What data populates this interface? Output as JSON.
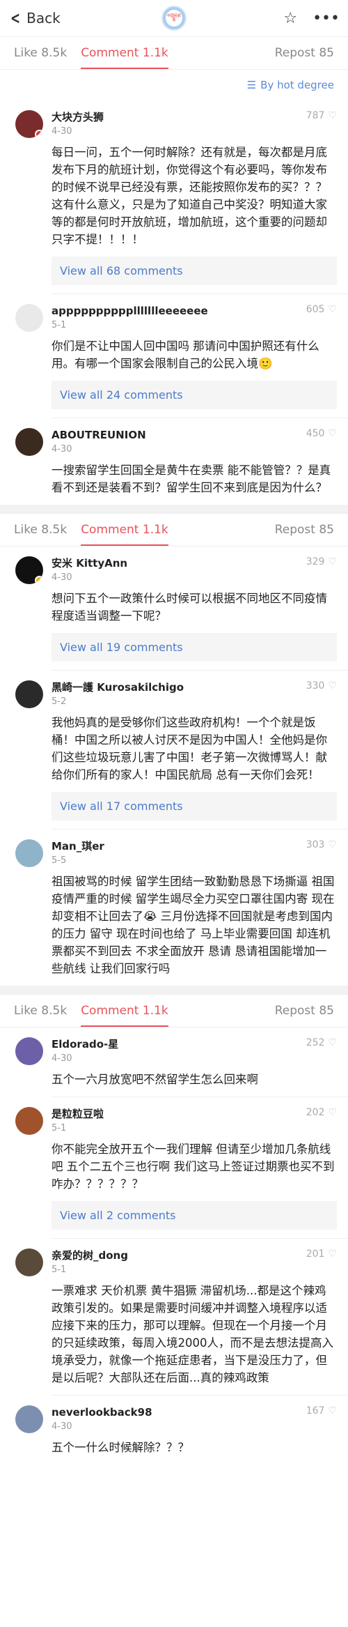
{
  "topbar": {
    "back_label": "Back",
    "logo_text": "中国民航局"
  },
  "tabs": {
    "like": "Like 8.5k",
    "comment": "Comment 1.1k",
    "repost": "Repost 85"
  },
  "sort": {
    "label": "By hot degree"
  },
  "sections": [
    {
      "comments": [
        {
          "name": "大块方头狮",
          "date": "4-30",
          "likes": "787",
          "avatar_color": "#7a2b2b",
          "badge_color": "#e03b3b",
          "text": "每日一问，五个一何时解除？还有就是，每次都是月底发布下月的航班计划，你觉得这个有必要吗，等你发布的时候不说早已经没有票，还能按照你发布的买？？？这有什么意义，只是为了知道自己中奖没？明知道大家等的都是何时开放航班，增加航班，这个重要的问题却只字不提！！！！",
          "view_all": "View all 68 comments"
        },
        {
          "name": "appppppppppllllllleeeeeee",
          "date": "5-1",
          "likes": "605",
          "avatar_color": "#e9e9e9",
          "badge_color": "",
          "text": "你们是不让中国人回中国吗 那请问中国护照还有什么用。有哪一个国家会限制自己的公民入境🙂",
          "view_all": "View all 24 comments"
        },
        {
          "name": "ABOUTREUNION",
          "date": "4-30",
          "likes": "450",
          "avatar_color": "#3b2a20",
          "badge_color": "",
          "text": "一搜索留学生回国全是黄牛在卖票 能不能管管？？是真看不到还是装看不到？留学生回不来到底是因为什么？",
          "view_all": ""
        }
      ]
    },
    {
      "comments": [
        {
          "name": "安米 KittyAnn",
          "date": "4-30",
          "likes": "329",
          "avatar_color": "#111111",
          "badge_color": "#f2b705",
          "text": "想问下五个一政策什么时候可以根据不同地区不同疫情程度适当调整一下呢？",
          "view_all": "View all 19 comments"
        },
        {
          "name": "黑崎一護 Kurosakilchigo",
          "date": "5-2",
          "likes": "330",
          "avatar_color": "#2a2a2a",
          "badge_color": "",
          "text": "我他妈真的是受够你们这些政府机构！一个个就是饭桶！中国之所以被人讨厌不是因为中国人！全他妈是你们这些垃圾玩意儿害了中国！老子第一次微博骂人！献给你们所有的家人！中国民航局 总有一天你们会死！",
          "view_all": "View all 17 comments"
        },
        {
          "name": "Man_琪er",
          "date": "5-5",
          "likes": "303",
          "avatar_color": "#8fb3c9",
          "badge_color": "",
          "text": "祖国被骂的时候 留学生团结一致勤勤恳恳下场撕逼 祖国疫情严重的时候 留学生竭尽全力买空口罩往国内寄 现在却变相不让回去了😭 三月份选择不回国就是考虑到国内的压力 留守 现在时间也给了 马上毕业需要回国 却连机票都买不到回去 不求全面放开 恳请 恳请祖国能增加一些航线 让我们回家行吗",
          "view_all": ""
        }
      ]
    },
    {
      "comments": [
        {
          "name": "Eldorado-星",
          "date": "4-30",
          "likes": "252",
          "avatar_color": "#6d5fa8",
          "badge_color": "",
          "text": "五个一六月放宽吧不然留学生怎么回来啊",
          "view_all": ""
        },
        {
          "name": "是粒粒豆啦",
          "date": "5-1",
          "likes": "202",
          "avatar_color": "#a0522d",
          "badge_color": "",
          "text": "你不能完全放开五个一我们理解 但请至少增加几条航线吧 五个二五个三也行啊 我们这马上签证过期票也买不到 咋办？？？？？？",
          "view_all": "View all 2 comments"
        },
        {
          "name": "亲爱的树_dong",
          "date": "5-1",
          "likes": "201",
          "avatar_color": "#5a4a3a",
          "badge_color": "",
          "text": "一票难求 天价机票 黄牛猖獗 滞留机场...都是这个辣鸡政策引发的。如果是需要时间缓冲并调整入境程序以适应接下来的压力，那可以理解。但现在一个月接一个月的只延续政策，每周入境2000人，而不是去想法提高入境承受力，就像一个拖延症患者，当下是没压力了，但是以后呢？大部队还在后面...真的辣鸡政策",
          "view_all": ""
        },
        {
          "name": "neverlookback98",
          "date": "4-30",
          "likes": "167",
          "avatar_color": "#7d8fb0",
          "badge_color": "",
          "text": "五个一什么时候解除？？？",
          "view_all": ""
        }
      ]
    }
  ]
}
